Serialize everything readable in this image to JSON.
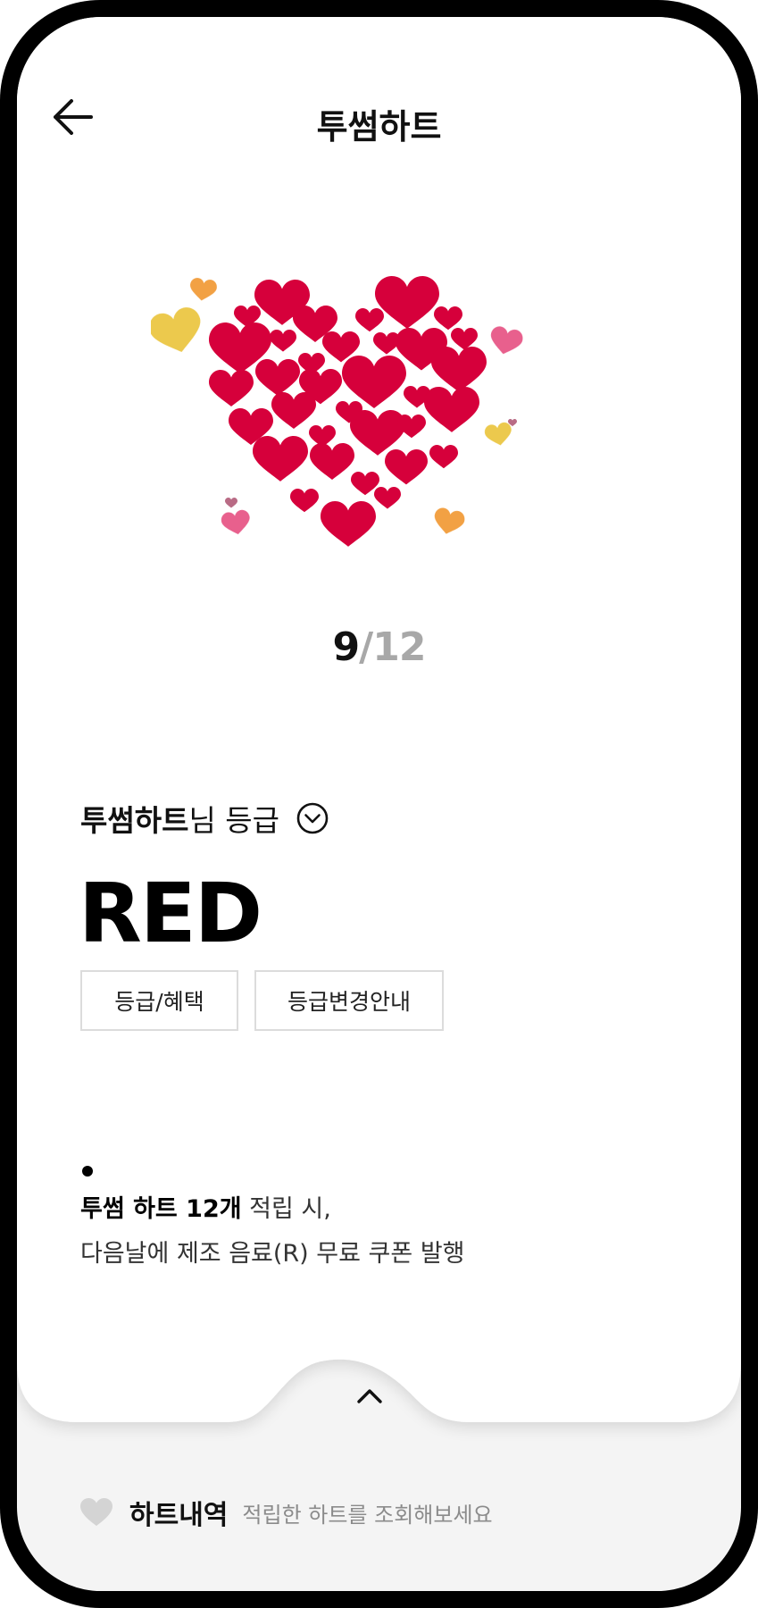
{
  "header": {
    "title": "투썸하트",
    "back_icon": "arrow-left-icon"
  },
  "hearts": {
    "main_color": "#d6003b",
    "accent_colors": [
      "#f2a144",
      "#ecc94d",
      "#e8608d",
      "#b96b85"
    ]
  },
  "progress": {
    "current": "9",
    "separator": "/",
    "total": "12"
  },
  "grade": {
    "nickname": "투썸하트",
    "suffix": "님 등급",
    "toggle_icon": "chevron-circle-down-icon",
    "name": "RED"
  },
  "buttons": {
    "benefit": "등급/혜택",
    "change_guide": "등급변경안내"
  },
  "notice": {
    "bold": "투썸 하트 12개",
    "rest_line1": " 적립 시,",
    "line2": "다음날에 제조 음료(R) 무료 쿠폰 발행"
  },
  "bottom_sheet": {
    "expand_icon": "chevron-up-icon",
    "history_icon": "heart-icon",
    "history_label": "하트내역",
    "history_hint": "적립한 하트를 조회해보세요"
  }
}
